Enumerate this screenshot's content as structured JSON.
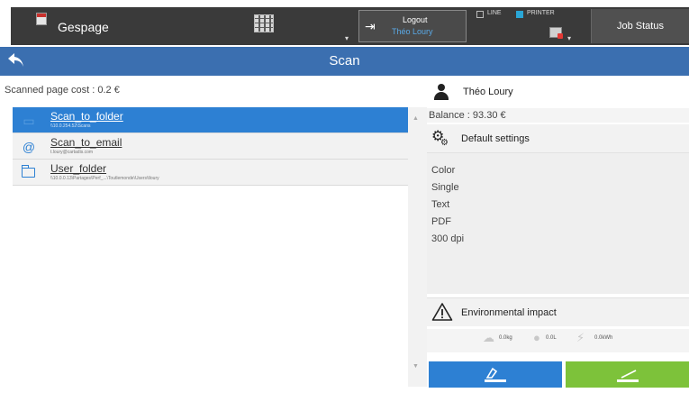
{
  "topbar": {
    "app_name": "Gespage",
    "logout_label": "Logout",
    "logout_user": "Théo Loury",
    "line_label": "LINE",
    "printer_label": "PRINTER",
    "job_status_label": "Job Status"
  },
  "header": {
    "title": "Scan"
  },
  "left": {
    "page_cost": "Scanned page cost : 0.2 €",
    "destinations": [
      {
        "name": "Scan_to_folder",
        "path": "\\\\10.0.254.52\\Scans",
        "icon": "folder-network-icon",
        "selected": true
      },
      {
        "name": "Scan_to_email",
        "path": "t.loury@cartadis.com",
        "icon": "at-icon",
        "selected": false
      },
      {
        "name": "User_folder",
        "path": "\\\\10.0.0.13\\Partages\\Perf_...\\Toutlemonde\\Users\\tloury",
        "icon": "folder-icon",
        "selected": false
      }
    ]
  },
  "right": {
    "user_name": "Théo Loury",
    "balance": "Balance : 93.30 €",
    "settings_title": "Default settings",
    "settings": [
      "Color",
      "Single",
      "Text",
      "PDF",
      "300 dpi"
    ],
    "env_title": "Environmental impact",
    "env_stats": {
      "co2": "0.0kg",
      "water": "0.0L",
      "energy": "0.0kWh"
    }
  },
  "colors": {
    "accent": "#3b6fb0",
    "selected": "#2d80d3",
    "print": "#7dc23a",
    "topbar": "#3a3a3a"
  }
}
